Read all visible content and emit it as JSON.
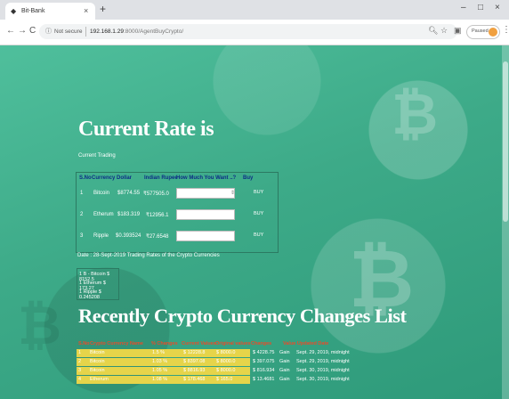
{
  "browser": {
    "tab_title": "Bit-Bank",
    "tab_close": "×",
    "new_tab": "+",
    "window_controls": [
      "–",
      "□",
      "×"
    ],
    "nav": {
      "back": "←",
      "forward": "→",
      "reload": "C"
    },
    "security_label": "Not secure",
    "url_host": "192.168.1.29",
    "url_rest": ":8000/AgentBuyCrypto/",
    "paused_label": "Paused",
    "menu": "⋮"
  },
  "page": {
    "heading": "Current Rate is",
    "subheading": "Current Trading",
    "rate_table": {
      "headers": [
        "S.No",
        "Currency",
        "Dollar",
        "Indian Rupee",
        "How Much You Want ..?",
        "Buy"
      ],
      "rows": [
        {
          "no": "1",
          "currency": "Bitcoin",
          "dollar": "$8774.55",
          "rupee": "₹577505.0",
          "qty_value": "",
          "buy_label": "BUY"
        },
        {
          "no": "2",
          "currency": "Etherum",
          "dollar": "$183.319",
          "rupee": "₹12956.1",
          "qty_value": "",
          "buy_label": "BUY"
        },
        {
          "no": "3",
          "currency": "Ripple",
          "dollar": "$0.393524",
          "rupee": "₹27.6548",
          "qty_value": "",
          "buy_label": "BUY"
        }
      ]
    },
    "date_note": "Date : 28-Sept-2019 Trading Rates of the Crypto Currencies",
    "reference": [
      "1 B - Bitcoin $ 8152.5",
      "1 Etherum   $ 173.27",
      "1 Ripple      $ 0.245208"
    ],
    "heading2": "Recently Crypto Currency Changes List",
    "changes_table": {
      "headers": [
        "S.No",
        "Crypto Currency Name",
        "% Changes",
        "Current Values",
        "Original values",
        "Changes",
        "Value Updated Date"
      ],
      "rows": [
        {
          "no": "1",
          "name": "Bitcoin",
          "pct": "1.5 %",
          "current": "$ 12228.8",
          "original": "$ 8000.0",
          "change": "$ 4228.75",
          "dir": "Gain",
          "date": "Sept. 29, 2019, midnight"
        },
        {
          "no": "2",
          "name": "Bitcoin",
          "pct": "1.03 %",
          "current": "$ 8397.08",
          "original": "$ 8000.0",
          "change": "$ 397.075",
          "dir": "Gain",
          "date": "Sept. 29, 2019, midnight"
        },
        {
          "no": "3",
          "name": "Bitcoin",
          "pct": "1.05 %",
          "current": "$ 8816.93",
          "original": "$ 8000.0",
          "change": "$ 816.934",
          "dir": "Gain",
          "date": "Sept. 30, 2019, midnight"
        },
        {
          "no": "4",
          "name": "Etherum",
          "pct": "1.08 %",
          "current": "$ 178.468",
          "original": "$ 165.0",
          "change": "$ 13.4681",
          "dir": "Gain",
          "date": "Sept. 30, 2019, midnight"
        }
      ]
    }
  },
  "colors": {
    "page_background": "#3daa88",
    "table_header_text": "#0d2d86",
    "changes_header_text": "#e84c2b",
    "changes_highlight": "#e6d44a"
  }
}
